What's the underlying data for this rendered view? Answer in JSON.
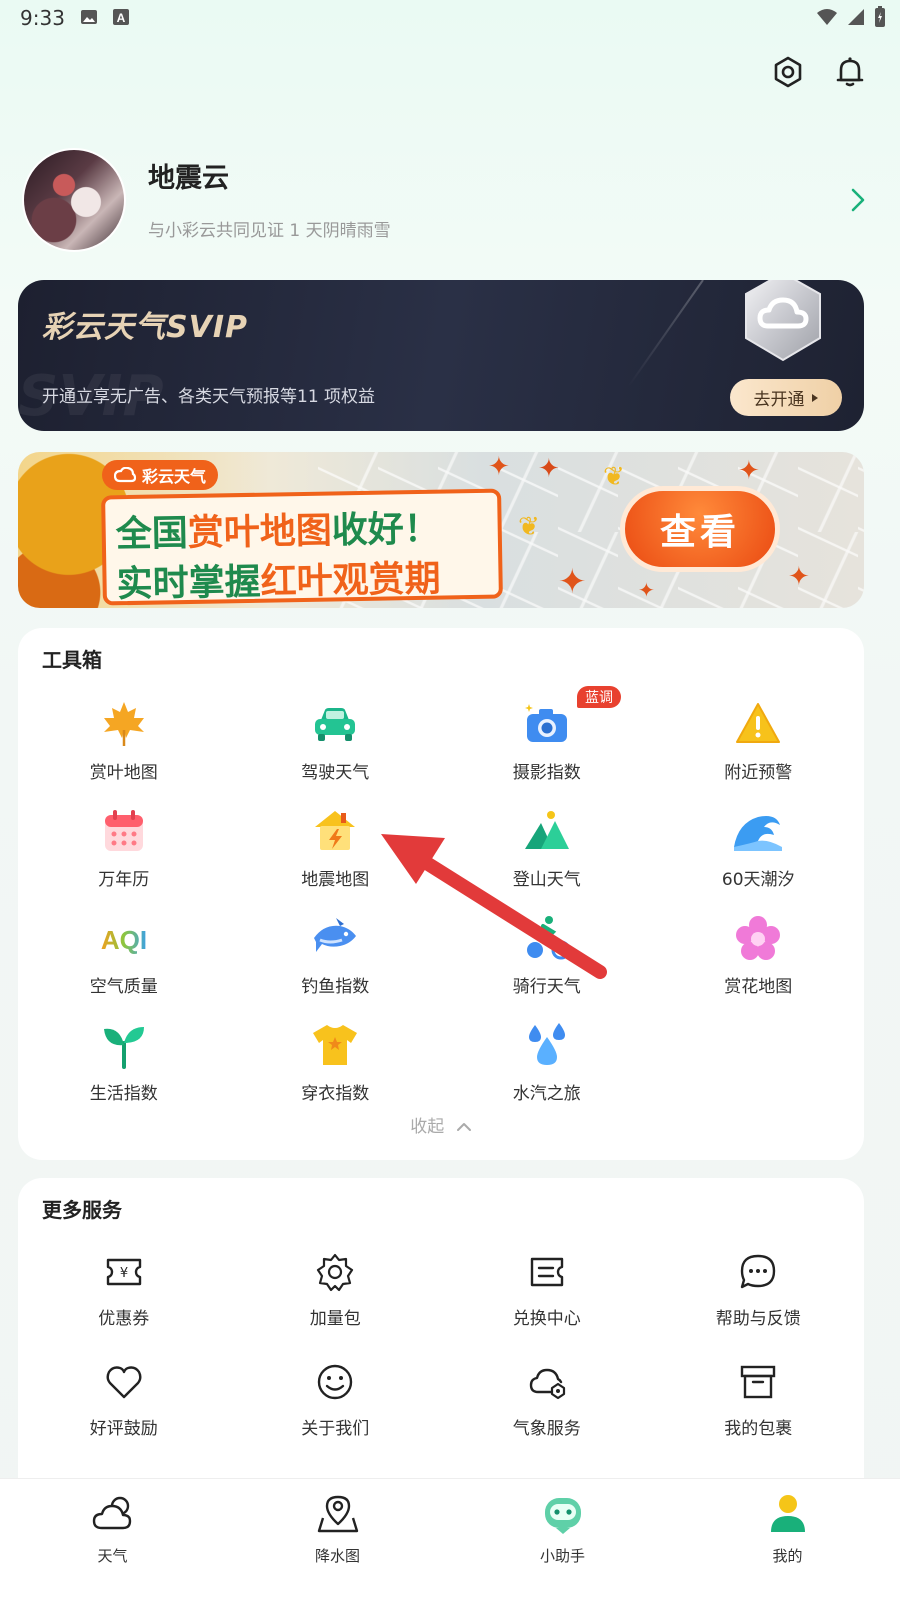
{
  "status_bar": {
    "time": "9:33",
    "icons": [
      "image-icon",
      "a-letter-icon",
      "wifi-icon",
      "signal-icon",
      "battery-icon"
    ]
  },
  "top_actions": {
    "icons": [
      "settings-icon",
      "bell-icon"
    ]
  },
  "profile": {
    "name": "地震云",
    "subtitle": "与小彩云共同见证 1 天阴晴雨雪"
  },
  "svip": {
    "title": "彩云天气SVIP",
    "watermark": "SVIP",
    "description": "开通立享无广告、各类天气预报等11 项权益",
    "button": "去开通"
  },
  "banner": {
    "logo_text": "彩云天气",
    "line1_a": "全国",
    "line1_b": "赏叶地图",
    "line1_c": "收好！",
    "line2_a": "实时掌握",
    "line2_b": "红叶观赏期",
    "button": "查看"
  },
  "toolbox": {
    "title": "工具箱",
    "items": [
      {
        "label": "赏叶地图",
        "icon": "maple-leaf-icon"
      },
      {
        "label": "驾驶天气",
        "icon": "car-icon"
      },
      {
        "label": "摄影指数",
        "icon": "camera-icon",
        "badge": "蓝调"
      },
      {
        "label": "附近预警",
        "icon": "warning-icon"
      },
      {
        "label": "万年历",
        "icon": "calendar-icon"
      },
      {
        "label": "地震地图",
        "icon": "earthquake-house-icon"
      },
      {
        "label": "登山天气",
        "icon": "mountain-icon"
      },
      {
        "label": "60天潮汐",
        "icon": "wave-icon"
      },
      {
        "label": "空气质量",
        "icon": "aqi-icon"
      },
      {
        "label": "钓鱼指数",
        "icon": "fish-icon"
      },
      {
        "label": "骑行天气",
        "icon": "cycling-icon"
      },
      {
        "label": "赏花地图",
        "icon": "flower-icon"
      },
      {
        "label": "生活指数",
        "icon": "sprout-icon"
      },
      {
        "label": "穿衣指数",
        "icon": "tshirt-icon"
      },
      {
        "label": "水汽之旅",
        "icon": "water-drops-icon"
      }
    ],
    "collapse_label": "收起"
  },
  "more_services": {
    "title": "更多服务",
    "items": [
      {
        "label": "优惠券",
        "icon": "coupon-icon"
      },
      {
        "label": "加量包",
        "icon": "gear-badge-icon"
      },
      {
        "label": "兑换中心",
        "icon": "exchange-icon"
      },
      {
        "label": "帮助与反馈",
        "icon": "chat-icon"
      },
      {
        "label": "好评鼓励",
        "icon": "heart-icon"
      },
      {
        "label": "关于我们",
        "icon": "smile-icon"
      },
      {
        "label": "气象服务",
        "icon": "cloud-service-icon"
      },
      {
        "label": "我的包裹",
        "icon": "box-icon"
      }
    ]
  },
  "bottom_nav": {
    "items": [
      {
        "label": "天气",
        "icon": "weather-cloud-icon"
      },
      {
        "label": "降水图",
        "icon": "map-pin-icon"
      },
      {
        "label": "小助手",
        "icon": "assistant-icon"
      },
      {
        "label": "我的",
        "icon": "user-icon",
        "active": true
      }
    ]
  },
  "colors": {
    "accent_green": "#19b07a",
    "svip_gold": "#e7d3b5",
    "banner_orange": "#f0621a",
    "badge_red": "#e8412f",
    "annotation_arrow": "#e23a3a"
  }
}
